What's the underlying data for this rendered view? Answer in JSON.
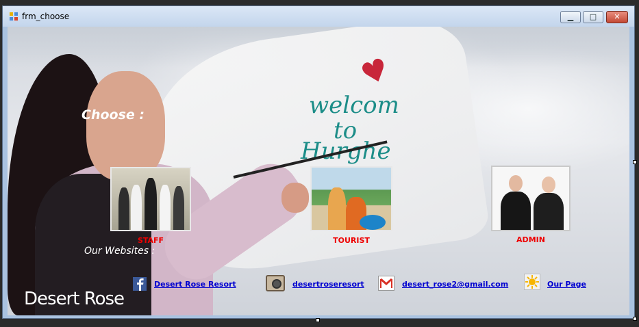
{
  "window": {
    "title": "frm_choose",
    "minimize_label": "▁",
    "maximize_label": "□",
    "close_label": "✕"
  },
  "background": {
    "painted_lines": [
      "welcom",
      "to",
      "Hurghe"
    ],
    "logo": "Desert Rose"
  },
  "main": {
    "choose_label": "Choose :",
    "websites_label": "Our Websites :"
  },
  "choices": [
    {
      "label": "STAFF"
    },
    {
      "label": "TOURIST"
    },
    {
      "label": "ADMIN"
    }
  ],
  "links": [
    {
      "icon": "facebook-icon",
      "label": "Desert Rose Resort"
    },
    {
      "icon": "instagram-icon",
      "label": "desertroseresort"
    },
    {
      "icon": "gmail-icon",
      "label": "desert_rose2@gmail.com"
    },
    {
      "icon": "sun-icon",
      "label": "Our Page"
    }
  ],
  "colors": {
    "caption": "#e00000",
    "link": "#0000d0",
    "close_button": "#c34935"
  }
}
